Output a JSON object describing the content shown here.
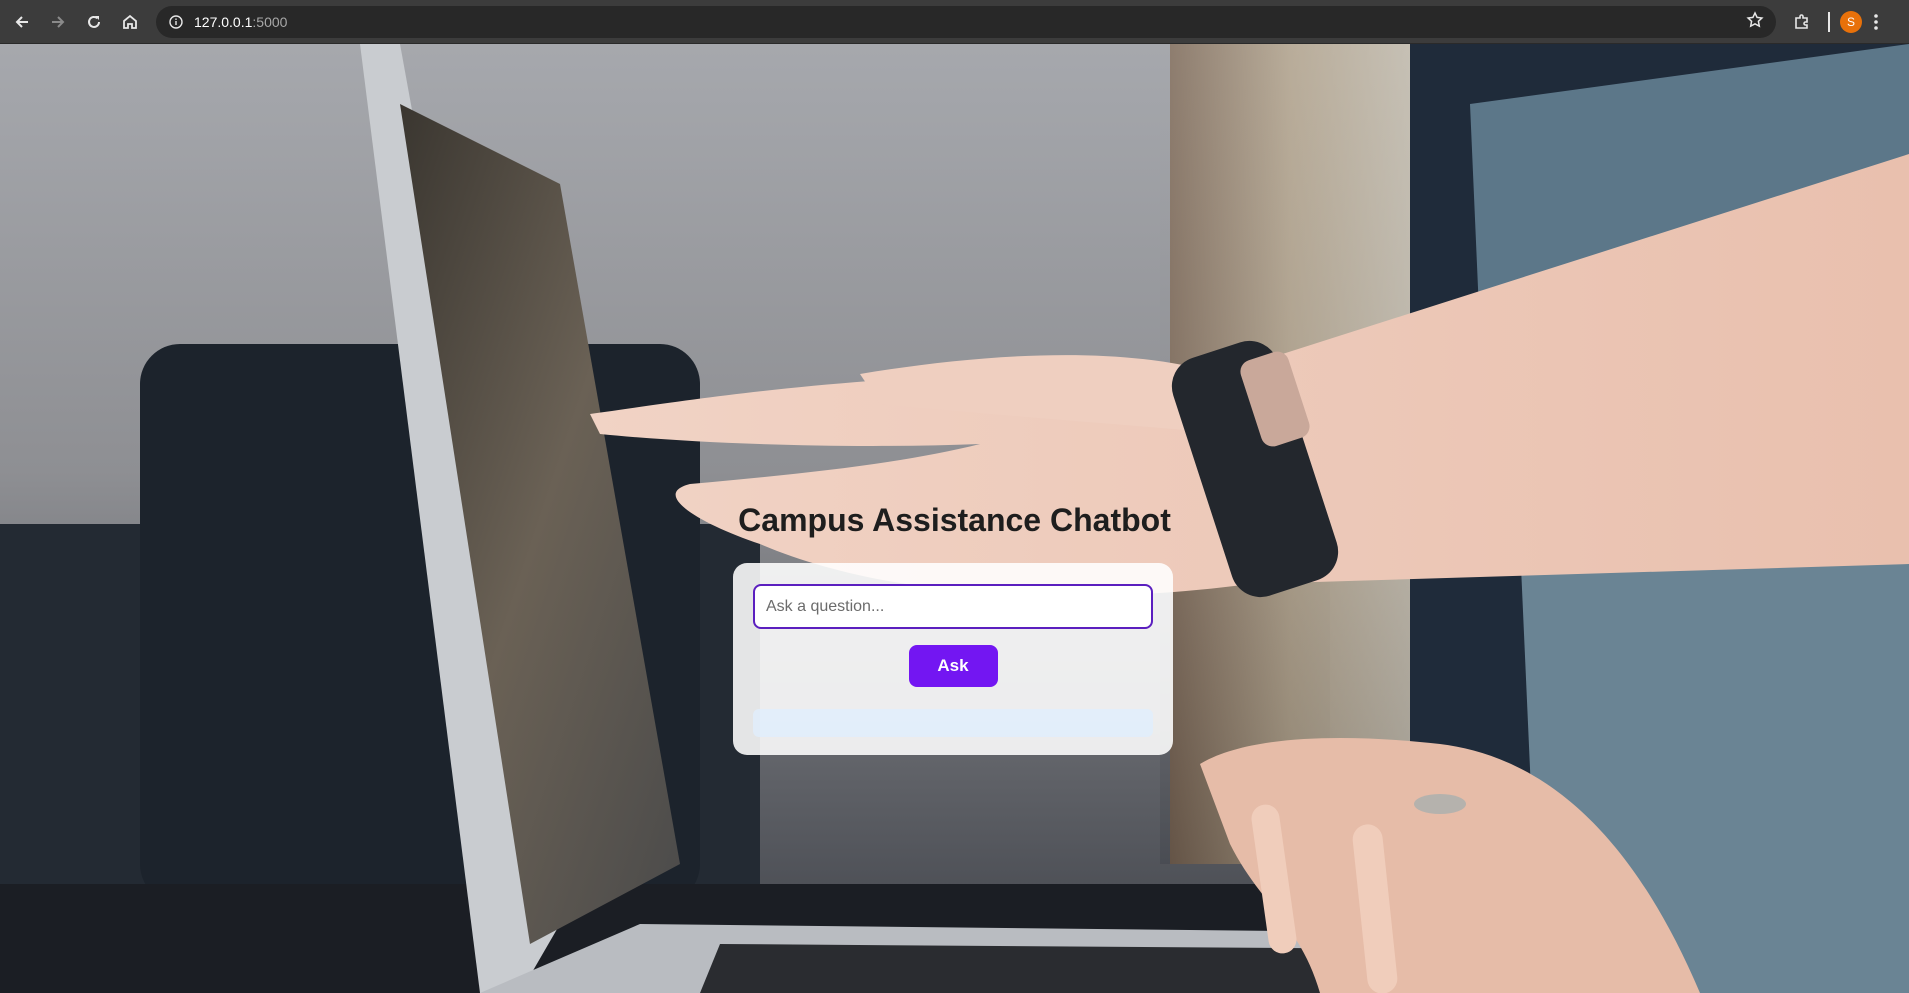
{
  "browser": {
    "url_host": "127.0.0.1",
    "url_port": ":5000",
    "profile_initial": "S",
    "icons": {
      "back": "arrow-left-icon",
      "forward": "arrow-right-icon",
      "reload": "reload-icon",
      "home": "home-icon",
      "site_info": "info-icon",
      "bookmark": "star-icon",
      "extensions": "puzzle-icon",
      "menu": "vertical-dots-icon"
    },
    "colors": {
      "toolbar": "#3c3c3c",
      "avatar": "#e8710a"
    }
  },
  "page": {
    "title": "Campus Assistance Chatbot",
    "input_placeholder": "Ask a question...",
    "input_value": "",
    "ask_label": "Ask",
    "response_text": "",
    "colors": {
      "accent": "#7316f2",
      "input_border": "#5b1fbf",
      "title": "#1e1e1e"
    }
  }
}
